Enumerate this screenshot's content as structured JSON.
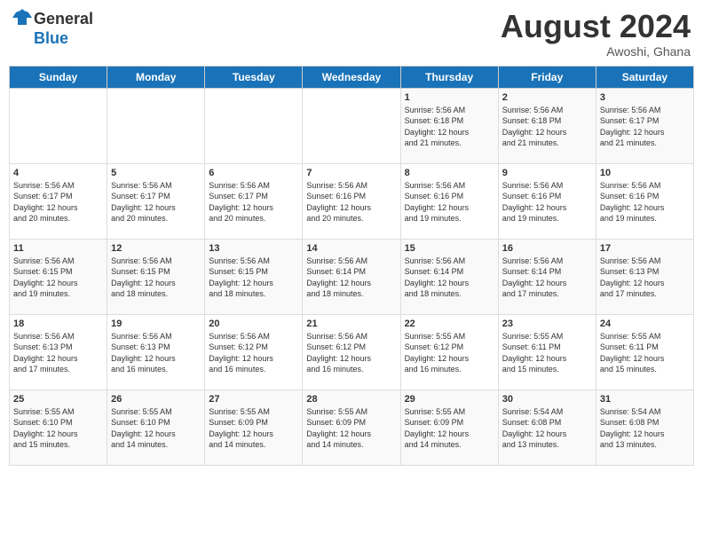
{
  "header": {
    "logo_line1": "General",
    "logo_line2": "Blue",
    "month_year": "August 2024",
    "location": "Awoshi, Ghana"
  },
  "days_of_week": [
    "Sunday",
    "Monday",
    "Tuesday",
    "Wednesday",
    "Thursday",
    "Friday",
    "Saturday"
  ],
  "weeks": [
    [
      {
        "num": "",
        "info": ""
      },
      {
        "num": "",
        "info": ""
      },
      {
        "num": "",
        "info": ""
      },
      {
        "num": "",
        "info": ""
      },
      {
        "num": "1",
        "info": "Sunrise: 5:56 AM\nSunset: 6:18 PM\nDaylight: 12 hours\nand 21 minutes."
      },
      {
        "num": "2",
        "info": "Sunrise: 5:56 AM\nSunset: 6:18 PM\nDaylight: 12 hours\nand 21 minutes."
      },
      {
        "num": "3",
        "info": "Sunrise: 5:56 AM\nSunset: 6:17 PM\nDaylight: 12 hours\nand 21 minutes."
      }
    ],
    [
      {
        "num": "4",
        "info": "Sunrise: 5:56 AM\nSunset: 6:17 PM\nDaylight: 12 hours\nand 20 minutes."
      },
      {
        "num": "5",
        "info": "Sunrise: 5:56 AM\nSunset: 6:17 PM\nDaylight: 12 hours\nand 20 minutes."
      },
      {
        "num": "6",
        "info": "Sunrise: 5:56 AM\nSunset: 6:17 PM\nDaylight: 12 hours\nand 20 minutes."
      },
      {
        "num": "7",
        "info": "Sunrise: 5:56 AM\nSunset: 6:16 PM\nDaylight: 12 hours\nand 20 minutes."
      },
      {
        "num": "8",
        "info": "Sunrise: 5:56 AM\nSunset: 6:16 PM\nDaylight: 12 hours\nand 19 minutes."
      },
      {
        "num": "9",
        "info": "Sunrise: 5:56 AM\nSunset: 6:16 PM\nDaylight: 12 hours\nand 19 minutes."
      },
      {
        "num": "10",
        "info": "Sunrise: 5:56 AM\nSunset: 6:16 PM\nDaylight: 12 hours\nand 19 minutes."
      }
    ],
    [
      {
        "num": "11",
        "info": "Sunrise: 5:56 AM\nSunset: 6:15 PM\nDaylight: 12 hours\nand 19 minutes."
      },
      {
        "num": "12",
        "info": "Sunrise: 5:56 AM\nSunset: 6:15 PM\nDaylight: 12 hours\nand 18 minutes."
      },
      {
        "num": "13",
        "info": "Sunrise: 5:56 AM\nSunset: 6:15 PM\nDaylight: 12 hours\nand 18 minutes."
      },
      {
        "num": "14",
        "info": "Sunrise: 5:56 AM\nSunset: 6:14 PM\nDaylight: 12 hours\nand 18 minutes."
      },
      {
        "num": "15",
        "info": "Sunrise: 5:56 AM\nSunset: 6:14 PM\nDaylight: 12 hours\nand 18 minutes."
      },
      {
        "num": "16",
        "info": "Sunrise: 5:56 AM\nSunset: 6:14 PM\nDaylight: 12 hours\nand 17 minutes."
      },
      {
        "num": "17",
        "info": "Sunrise: 5:56 AM\nSunset: 6:13 PM\nDaylight: 12 hours\nand 17 minutes."
      }
    ],
    [
      {
        "num": "18",
        "info": "Sunrise: 5:56 AM\nSunset: 6:13 PM\nDaylight: 12 hours\nand 17 minutes."
      },
      {
        "num": "19",
        "info": "Sunrise: 5:56 AM\nSunset: 6:13 PM\nDaylight: 12 hours\nand 16 minutes."
      },
      {
        "num": "20",
        "info": "Sunrise: 5:56 AM\nSunset: 6:12 PM\nDaylight: 12 hours\nand 16 minutes."
      },
      {
        "num": "21",
        "info": "Sunrise: 5:56 AM\nSunset: 6:12 PM\nDaylight: 12 hours\nand 16 minutes."
      },
      {
        "num": "22",
        "info": "Sunrise: 5:55 AM\nSunset: 6:12 PM\nDaylight: 12 hours\nand 16 minutes."
      },
      {
        "num": "23",
        "info": "Sunrise: 5:55 AM\nSunset: 6:11 PM\nDaylight: 12 hours\nand 15 minutes."
      },
      {
        "num": "24",
        "info": "Sunrise: 5:55 AM\nSunset: 6:11 PM\nDaylight: 12 hours\nand 15 minutes."
      }
    ],
    [
      {
        "num": "25",
        "info": "Sunrise: 5:55 AM\nSunset: 6:10 PM\nDaylight: 12 hours\nand 15 minutes."
      },
      {
        "num": "26",
        "info": "Sunrise: 5:55 AM\nSunset: 6:10 PM\nDaylight: 12 hours\nand 14 minutes."
      },
      {
        "num": "27",
        "info": "Sunrise: 5:55 AM\nSunset: 6:09 PM\nDaylight: 12 hours\nand 14 minutes."
      },
      {
        "num": "28",
        "info": "Sunrise: 5:55 AM\nSunset: 6:09 PM\nDaylight: 12 hours\nand 14 minutes."
      },
      {
        "num": "29",
        "info": "Sunrise: 5:55 AM\nSunset: 6:09 PM\nDaylight: 12 hours\nand 14 minutes."
      },
      {
        "num": "30",
        "info": "Sunrise: 5:54 AM\nSunset: 6:08 PM\nDaylight: 12 hours\nand 13 minutes."
      },
      {
        "num": "31",
        "info": "Sunrise: 5:54 AM\nSunset: 6:08 PM\nDaylight: 12 hours\nand 13 minutes."
      }
    ]
  ]
}
